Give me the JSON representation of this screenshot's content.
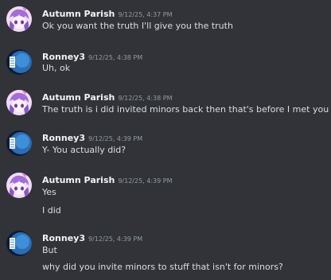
{
  "messages": [
    {
      "author": "Autumn Parish",
      "timestamp": "9/12/25, 4:37 PM",
      "avatar_icon": "anime-girl-avatar-icon",
      "lines": [
        "Ok you want the truth I'll give you the truth"
      ]
    },
    {
      "author": "Ronney3",
      "timestamp": "9/12/25, 4:38 PM",
      "avatar_icon": "blue-sphere-avatar-icon",
      "lines": [
        "Uh, ok"
      ]
    },
    {
      "author": "Autumn Parish",
      "timestamp": "9/12/25, 4:38 PM",
      "avatar_icon": "anime-girl-avatar-icon",
      "lines": [
        "The truth is i did invited minors back then that's before I met you"
      ]
    },
    {
      "author": "Ronney3",
      "timestamp": "9/12/25, 4:39 PM",
      "avatar_icon": "blue-sphere-avatar-icon",
      "lines": [
        "Y- You actually did?"
      ]
    },
    {
      "author": "Autumn Parish",
      "timestamp": "9/12/25, 4:39 PM",
      "avatar_icon": "anime-girl-avatar-icon",
      "lines": [
        "Yes",
        "I did"
      ]
    },
    {
      "author": "Ronney3",
      "timestamp": "9/12/25, 4:39 PM",
      "avatar_icon": "blue-sphere-avatar-icon",
      "lines": [
        "But",
        "why did you invite minors to stuff that isn't for minors?"
      ]
    }
  ],
  "colors": {
    "background": "#313338",
    "username": "#f2f3f5",
    "timestamp": "#949ba4",
    "message_text": "#dbdee1"
  }
}
